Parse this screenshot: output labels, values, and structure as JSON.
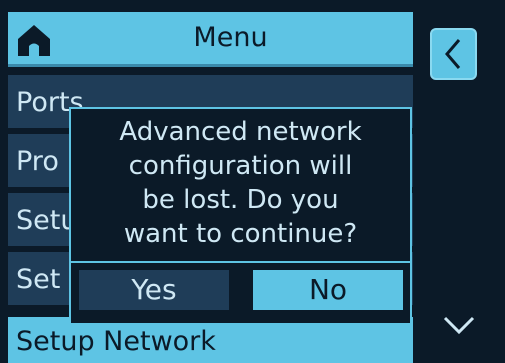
{
  "header": {
    "title": "Menu",
    "home_icon": "home-icon"
  },
  "menu_items": [
    {
      "label": "Ports"
    },
    {
      "label": "Pro"
    },
    {
      "label": "Setu"
    },
    {
      "label": "Set"
    },
    {
      "label": "Setup Network",
      "selected": true
    }
  ],
  "nav": {
    "back_icon": "chevron-left-icon",
    "down_icon": "chevron-down-icon"
  },
  "dialog": {
    "message_lines": [
      "Advanced network",
      "configuration will",
      "be lost. Do you",
      "want to continue?"
    ],
    "yes_label": "Yes",
    "no_label": "No"
  },
  "colors": {
    "accent": "#5ec4e4",
    "background": "#0b1a28",
    "item": "#1f3d58",
    "text_light": "#cfe8f4"
  }
}
